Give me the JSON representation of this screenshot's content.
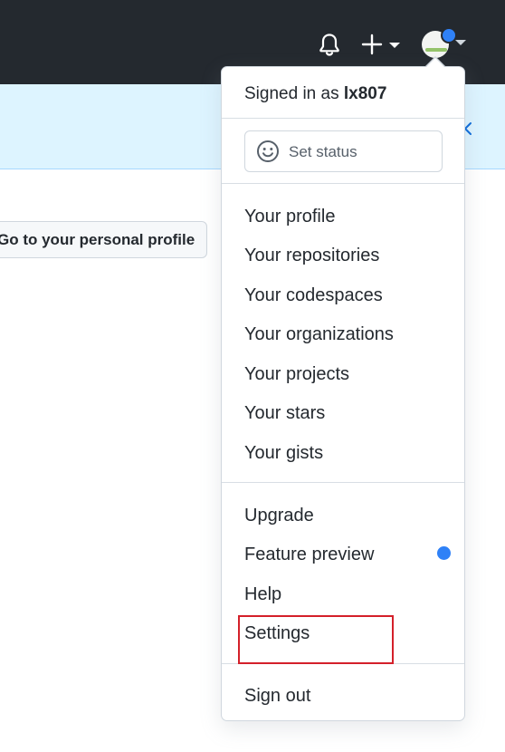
{
  "header": {
    "notifications_icon": "bell-icon",
    "create_icon": "plus-icon",
    "avatar_icon": "avatar-icon"
  },
  "page": {
    "profile_button_label": "Go to your personal profile"
  },
  "menu": {
    "signed_in_prefix": "Signed in as ",
    "username": "lx807",
    "set_status_label": "Set status",
    "profile_items": [
      {
        "label": "Your profile"
      },
      {
        "label": "Your repositories"
      },
      {
        "label": "Your codespaces"
      },
      {
        "label": "Your organizations"
      },
      {
        "label": "Your projects"
      },
      {
        "label": "Your stars"
      },
      {
        "label": "Your gists"
      }
    ],
    "secondary_items": [
      {
        "label": "Upgrade"
      },
      {
        "label": "Feature preview"
      },
      {
        "label": "Help"
      },
      {
        "label": "Settings"
      }
    ],
    "sign_out_label": "Sign out"
  },
  "colors": {
    "header_bg": "#24292f",
    "banner_bg": "#ddf4ff",
    "accent_blue": "#2f81f7",
    "highlight_red": "#d4202a"
  }
}
